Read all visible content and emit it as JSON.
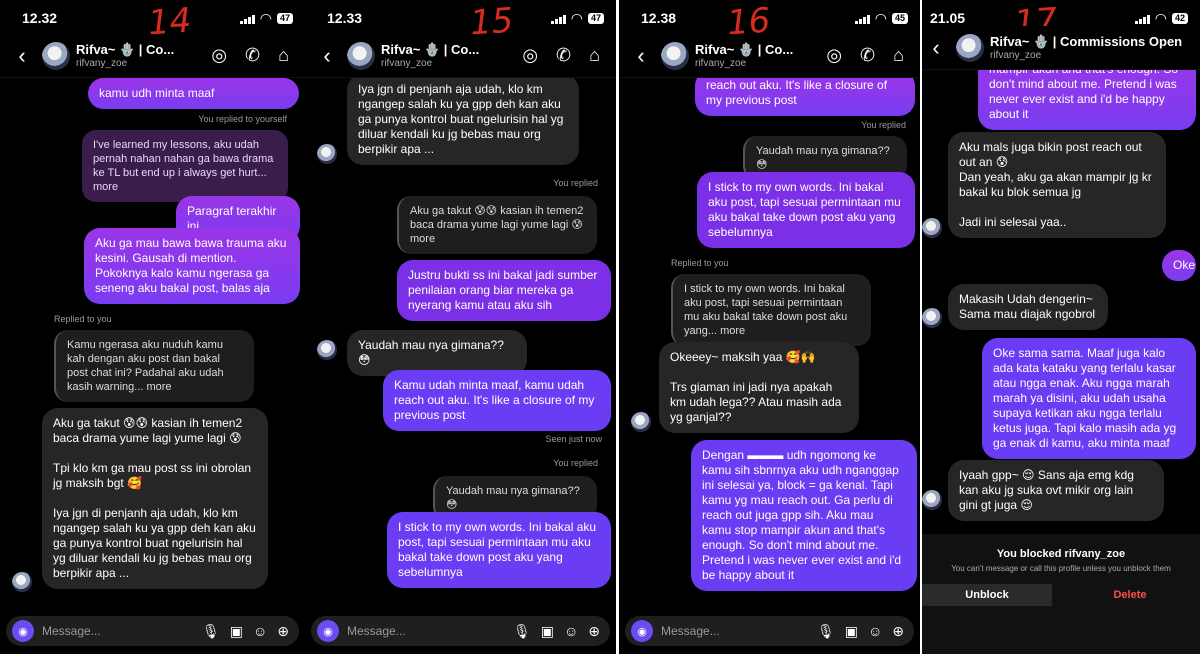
{
  "shared": {
    "contact_name": "Rifva~ 🪬 | Co...",
    "contact_name_full": "Rifva~ 🪬 | Commissions Open",
    "username": "rifvany_zoe",
    "composer_placeholder": "Message...",
    "back_glyph": "‹",
    "icons": [
      "game-icon",
      "phone-icon",
      "tag-icon",
      "mic-icon",
      "gallery-icon",
      "sticker-icon",
      "add-icon",
      "camera-icon"
    ]
  },
  "panels": [
    {
      "time": "12.32",
      "battery": "47",
      "scribble": "14",
      "messages": [
        {
          "kind": "sent",
          "text": "kamu udh minta maaf"
        },
        {
          "kind": "meta",
          "text": "You replied to yourself"
        },
        {
          "kind": "reply",
          "text": "I've learned my lessons, aku udah pernah nahan nahan ga bawa drama ke TL but end up i always get hurt... more"
        },
        {
          "kind": "sent",
          "text": "Paragraf terakhir ini"
        },
        {
          "kind": "sent",
          "text": "Aku ga mau bawa bawa trauma aku kesini. Gausah di mention. Pokoknya kalo kamu ngerasa ga seneng aku bakal post, balas aja"
        },
        {
          "kind": "meta",
          "text": "Replied to you"
        },
        {
          "kind": "reply",
          "text": "Kamu ngerasa aku nuduh kamu kah dengan aku post dan bakal post chat ini? Padahal aku udah kasih warning... more"
        },
        {
          "kind": "recv",
          "text": "Aku ga takut 😰😰 kasian ih temen2 baca drama yume lagi yume lagi 😰\n\nTpi klo km ga mau post ss ini obrolan jg maksih bgt 🥰\n\nIya jgn di penjanh aja udah, klo km ngangep salah ku ya gpp deh kan aku ga punya kontrol buat ngelurisin hal yg diluar kendali ku jg bebas mau org berpikir apa ..."
        }
      ]
    },
    {
      "time": "12.33",
      "battery": "47",
      "scribble": "15",
      "messages": [
        {
          "kind": "recv",
          "text": "Iya jgn di penjanh aja udah, klo km ngangep salah ku ya gpp deh kan aku ga punya kontrol buat ngelurisin hal yg diluar kendali ku jg bebas mau org berpikir apa ..."
        },
        {
          "kind": "meta",
          "text": "You replied"
        },
        {
          "kind": "reply",
          "text": "Aku ga takut 😰😰 kasian ih temen2 baca drama yume lagi yume lagi 😰 more"
        },
        {
          "kind": "sent",
          "text": "Justru bukti ss ini bakal jadi sumber penilaian orang biar mereka ga nyerang kamu atau aku sih"
        },
        {
          "kind": "recv",
          "text": "Yaudah mau nya gimana?? 😳"
        },
        {
          "kind": "sent",
          "text": "Kamu udah minta maaf, kamu udah reach out aku. It's like a closure of my previous post"
        },
        {
          "kind": "meta",
          "text": "Seen just now"
        },
        {
          "kind": "meta",
          "text": "You replied"
        },
        {
          "kind": "reply",
          "text": "Yaudah mau nya gimana?? 😳"
        },
        {
          "kind": "sent",
          "text": "I stick to my own words. Ini bakal aku post, tapi sesuai permintaan mu aku bakal take down post aku yang sebelumnya"
        }
      ]
    },
    {
      "time": "12.38",
      "battery": "45",
      "scribble": "16",
      "messages": [
        {
          "kind": "sent",
          "text": "reach out aku. It's like a closure of my previous post"
        },
        {
          "kind": "meta",
          "text": "You replied"
        },
        {
          "kind": "reply",
          "text": "Yaudah mau nya gimana?? 😳"
        },
        {
          "kind": "sent",
          "text": "I stick to my own words. Ini bakal aku post, tapi sesuai permintaan mu aku bakal take down post aku yang sebelumnya"
        },
        {
          "kind": "meta",
          "text": "Replied to you"
        },
        {
          "kind": "reply",
          "text": "I stick to my own words. Ini bakal aku post, tapi sesuai permintaan mu aku bakal take down post aku yang... more"
        },
        {
          "kind": "recv",
          "text": "Okeeey~ maksih yaa 🥰🙌\n\nTrs giaman ini jadi nya apakah km udah lega?? Atau masih ada yg ganjal??"
        },
        {
          "kind": "sent",
          "text": "Dengan ▬▬▬ udh ngomong ke kamu sih sbnrnya aku udh nganggap ini selesai ya, block = ga kenal. Tapi kamu yg mau reach out. Ga perlu di reach out juga gpp sih. Aku mau kamu stop mampir akun and that's enough. So don't mind about me. Pretend i was never ever exist and i'd be happy about it"
        }
      ]
    },
    {
      "time": "21.05",
      "battery": "42",
      "scribble": "17",
      "messages": [
        {
          "kind": "sent",
          "text": "mampir akun and that's enough. So don't mind about me. Pretend i was never ever exist and i'd be happy about it"
        },
        {
          "kind": "recv",
          "text": "Aku mals juga bikin post reach out out an 😰\nDan yeah, aku ga akan mampir jg kr bakal ku blok semua jg\n\nJadi ini selesai yaa.."
        },
        {
          "kind": "sent",
          "text": "Oke"
        },
        {
          "kind": "recv",
          "text": "Makasih Udah dengerin~\nSama mau diajak ngobrol"
        },
        {
          "kind": "sent",
          "text": "Oke sama sama. Maaf juga kalo ada kata kataku yang terlalu kasar atau ngga enak. Aku ngga marah marah ya disini, aku udah usaha supaya ketikan aku ngga terlalu ketus juga. Tapi kalo masih ada yg ga enak di kamu, aku minta maaf"
        },
        {
          "kind": "recv",
          "text": "Iyaah gpp~ 😌 Sans aja emg kdg kan aku jg suka ovt mikir org lain gini gt juga 😌"
        }
      ],
      "blocked": {
        "title": "You blocked rifvany_zoe",
        "subtitle": "You can't message or call this profile unless you unblock them",
        "unblock": "Unblock",
        "delete": "Delete"
      }
    }
  ]
}
